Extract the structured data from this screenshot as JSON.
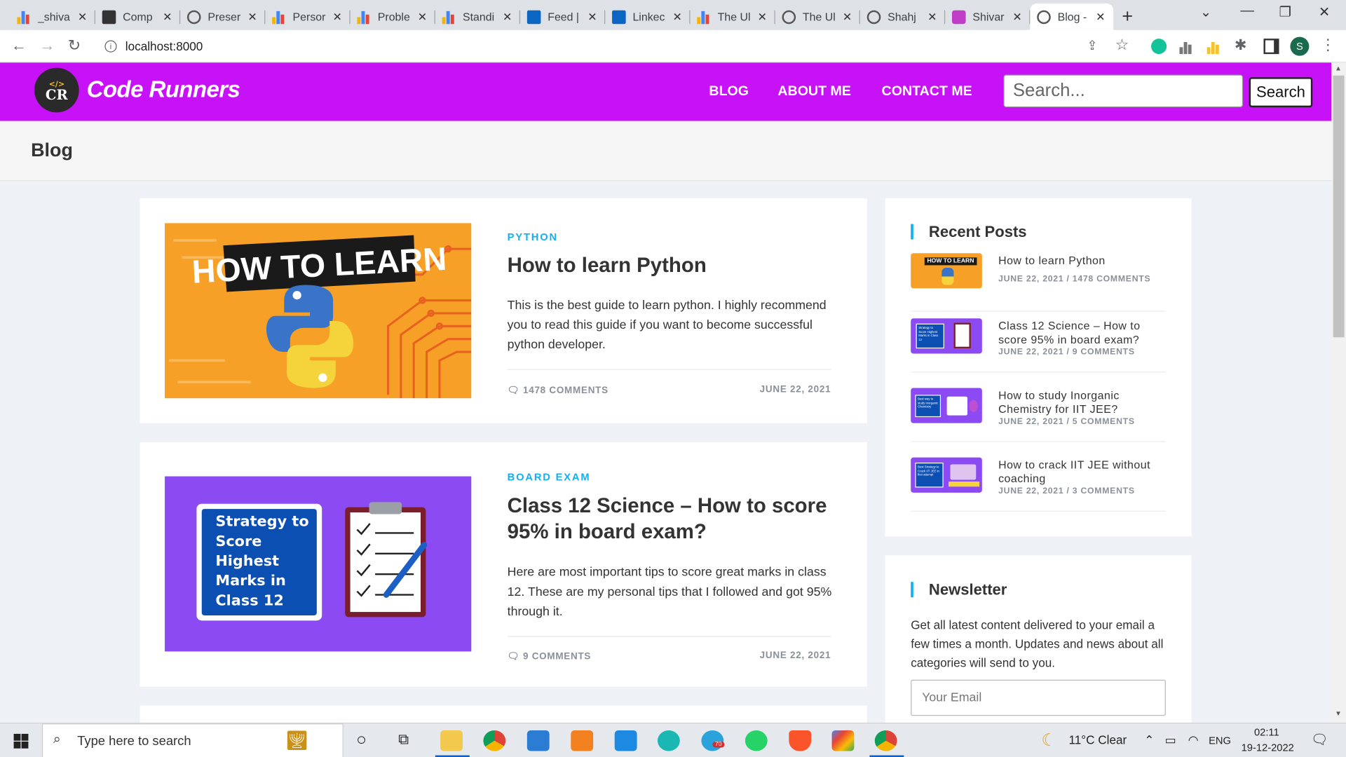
{
  "browser": {
    "tabs": [
      {
        "title": "_shiva",
        "icon": "bar-chart-icon"
      },
      {
        "title": "Comp",
        "icon": "cc-icon"
      },
      {
        "title": "Preser",
        "icon": "spy-icon"
      },
      {
        "title": "Persor",
        "icon": "bar-chart-icon"
      },
      {
        "title": "Proble",
        "icon": "bar-chart-icon"
      },
      {
        "title": "Standi",
        "icon": "bar-chart-icon"
      },
      {
        "title": "Feed |",
        "icon": "linkedin-icon"
      },
      {
        "title": "Linkec",
        "icon": "linkedin-icon"
      },
      {
        "title": "The Ul",
        "icon": "bar-chart-icon"
      },
      {
        "title": "The Ul",
        "icon": "doc-icon"
      },
      {
        "title": "Shahj",
        "icon": "globe-icon"
      },
      {
        "title": "Shivar",
        "icon": "sb-icon"
      },
      {
        "title": "Blog -",
        "icon": "site-logo-icon",
        "active": true
      }
    ],
    "url": "localhost:8000",
    "profile_initial": "S"
  },
  "header": {
    "logo_top": "</>",
    "logo_text": "CR",
    "brand": "Code Runners",
    "menu": [
      "BLOG",
      "ABOUT ME",
      "CONTACT ME"
    ],
    "search_placeholder": "Search...",
    "search_button": "Search"
  },
  "page_title": "Blog",
  "posts": [
    {
      "category": "PYTHON",
      "title": "How to learn Python",
      "excerpt": "This is the best guide to learn python. I highly recommend you to read this guide if you want to become successful python developer.",
      "comments": "1478 COMMENTS",
      "date": "JUNE 22, 2021",
      "image_text": "HOW TO LEARN"
    },
    {
      "category": "BOARD EXAM",
      "title": "Class 12 Science – How to score 95% in board exam?",
      "excerpt": "Here are most important tips to score great marks in class 12. These are my personal tips that I followed and got 95% through it.",
      "comments": "9 COMMENTS",
      "date": "JUNE 22, 2021",
      "image_text": "Strategy to Score Highest Marks in Class 12"
    }
  ],
  "sidebar": {
    "recent_title": "Recent Posts",
    "recent_posts": [
      {
        "title": "How to learn Python",
        "meta": "JUNE 22, 2021 / 1478 COMMENTS",
        "image_text": "HOW TO LEARN"
      },
      {
        "title": "Class 12 Science – How to score 95% in board exam?",
        "meta": "JUNE 22, 2021 / 9 COMMENTS",
        "image_text": "Strategy to Score Highest Marks in Class 12"
      },
      {
        "title": "How to study Inorganic Chemistry for IIT JEE?",
        "meta": "JUNE 22, 2021 / 5 COMMENTS",
        "image_text": "Best way to study Inorganic Chemistry"
      },
      {
        "title": "How to crack IIT JEE without coaching",
        "meta": "JUNE 22, 2021 / 3 COMMENTS",
        "image_text": "Best Strategy to Crack IIT JEE in first attempt"
      }
    ],
    "newsletter_title": "Newsletter",
    "newsletter_text": "Get all latest content delivered to your email a few times a month. Updates and news about all categories will send to you.",
    "email_placeholder": "Your Email"
  },
  "taskbar": {
    "search_placeholder": "Type here to search",
    "weather": "11°C  Clear",
    "language": "ENG",
    "time": "02:11",
    "date": "19-12-2022",
    "badge": "70"
  },
  "colors": {
    "header": "#c711f7",
    "accent": "#13aff0",
    "python_bg": "#f7a028",
    "board_bg": "#8c4bf2"
  }
}
